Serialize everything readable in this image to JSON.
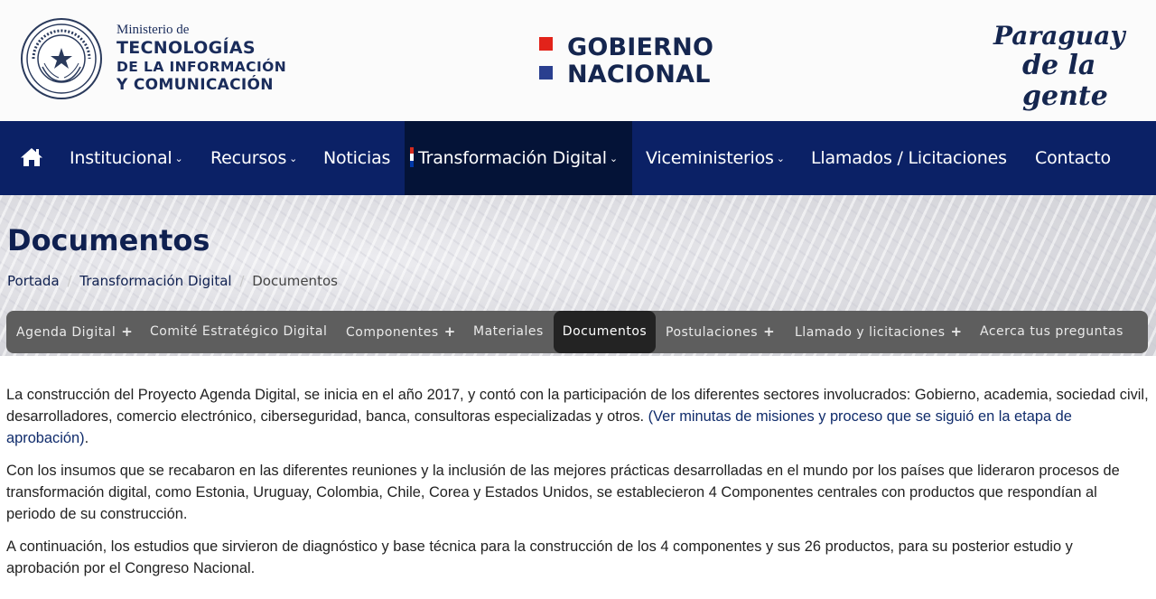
{
  "header": {
    "seal_text": "REPÚBLICA DEL PARAGUAY",
    "ministry": {
      "line1": "Ministerio de",
      "line2": "TECNOLOGÍAS",
      "line3": "DE LA INFORMACIÓN",
      "line4": "Y COMUNICACIÓN"
    },
    "gobierno": {
      "line1": "GOBIERNO",
      "line2": "NACIONAL"
    },
    "slogan": {
      "line1": "Paraguay",
      "line2": "de la gente"
    }
  },
  "nav": {
    "items": [
      {
        "label": "Institucional",
        "chevron": "⌄"
      },
      {
        "label": "Recursos",
        "chevron": "⌄"
      },
      {
        "label": "Noticias"
      },
      {
        "label": "Transformación Digital",
        "chevron": "⌄"
      },
      {
        "label": "Viceministerios",
        "chevron": "⌄"
      },
      {
        "label": "Llamados / Licitaciones"
      },
      {
        "label": "Contacto"
      }
    ],
    "colors": {
      "bar": "#0b2166",
      "active": "#041337"
    }
  },
  "page": {
    "title": "Documentos",
    "breadcrumb": [
      "Portada",
      "Transformación Digital",
      "Documentos"
    ]
  },
  "submenu": {
    "items": [
      {
        "label": "Agenda Digital",
        "plus": "+"
      },
      {
        "label": "Comité Estratégico Digital"
      },
      {
        "label": "Componentes",
        "plus": "+"
      },
      {
        "label": "Materiales"
      },
      {
        "label": "Documentos"
      },
      {
        "label": "Postulaciones",
        "plus": "+"
      },
      {
        "label": "Llamado y licitaciones",
        "plus": "+"
      },
      {
        "label": "Acerca tus preguntas"
      }
    ]
  },
  "content": {
    "p1_text": "La construcción del Proyecto Agenda Digital, se inicia en el año 2017, y contó con la participación de los diferentes sectores involucrados: Gobierno, academia, sociedad civil, desarrolladores, comercio electrónico, ciberseguridad, banca, consultoras especializadas y otros. ",
    "p1_link": "(Ver minutas de misiones y proceso que se siguió en la etapa de aprobación)",
    "p1_end": ".",
    "p2": "Con los insumos que se recabaron en las diferentes reuniones y la inclusión de las mejores prácticas desarrolladas en el mundo por los países que lideraron procesos de transformación digital, como Estonia, Uruguay, Colombia, Chile, Corea y Estados Unidos, se establecieron 4 Componentes centrales con productos que respondían al periodo de su construcción.",
    "p3": "A continuación, los estudios que sirvieron de diagnóstico y base técnica para la construcción de los 4 componentes y sus 26 productos, para su posterior estudio y aprobación por el Congreso Nacional."
  }
}
